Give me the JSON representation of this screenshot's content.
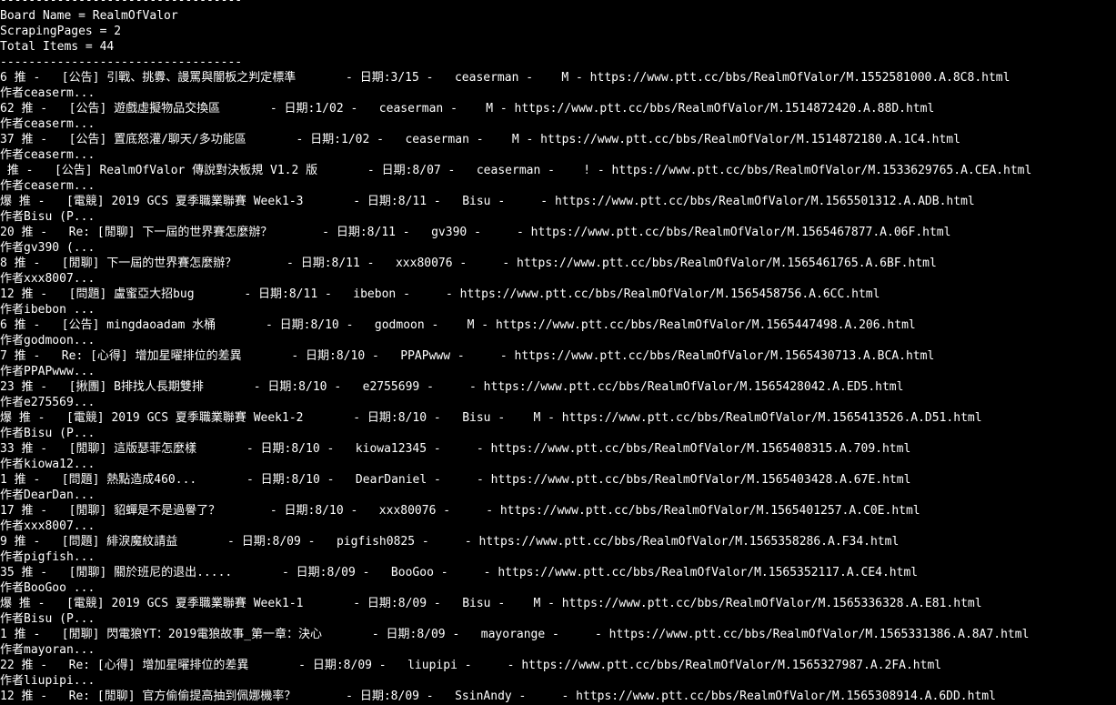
{
  "terminal": {
    "lines": [
      "----------------------------------",
      "Board Name = RealmOfValor",
      "ScrapingPages = 2",
      "Total Items = 44",
      "----------------------------------",
      "6 推 -   [公告] 引戰、挑釁、謾罵與闇板之判定標準       - 日期:3/15 -   ceaserman -    M - https://www.ptt.cc/bbs/RealmOfValor/M.1552581000.A.8C8.html",
      "作者ceaserm...",
      "62 推 -   [公告] 遊戲虛擬物品交換區       - 日期:1/02 -   ceaserman -    M - https://www.ptt.cc/bbs/RealmOfValor/M.1514872420.A.88D.html",
      "作者ceaserm...",
      "37 推 -   [公告] 置底怒灌/聊天/多功能區       - 日期:1/02 -   ceaserman -    M - https://www.ptt.cc/bbs/RealmOfValor/M.1514872180.A.1C4.html",
      "作者ceaserm...",
      " 推 -   [公告] RealmOfValor 傳說對決板規 V1.2 版       - 日期:8/07 -   ceaserman -    ! - https://www.ptt.cc/bbs/RealmOfValor/M.1533629765.A.CEA.html",
      "作者ceaserm...",
      "爆 推 -   [電競] 2019 GCS 夏季職業聯賽 Week1-3       - 日期:8/11 -   Bisu -     - https://www.ptt.cc/bbs/RealmOfValor/M.1565501312.A.ADB.html",
      "作者Bisu (P...",
      "20 推 -   Re: [閒聊] 下一屆的世界賽怎麼辦？       - 日期:8/11 -   gv390 -     - https://www.ptt.cc/bbs/RealmOfValor/M.1565467877.A.06F.html",
      "作者gv390 (...",
      "8 推 -   [閒聊] 下一屆的世界賽怎麼辦？       - 日期:8/11 -   xxx80076 -     - https://www.ptt.cc/bbs/RealmOfValor/M.1565461765.A.6BF.html",
      "作者xxx8007...",
      "12 推 -   [問題] 盧蜜亞大招bug       - 日期:8/11 -   ibebon -     - https://www.ptt.cc/bbs/RealmOfValor/M.1565458756.A.6CC.html",
      "作者ibebon ...",
      "6 推 -   [公告] mingdaoadam 水桶       - 日期:8/10 -   godmoon -    M - https://www.ptt.cc/bbs/RealmOfValor/M.1565447498.A.206.html",
      "作者godmoon...",
      "7 推 -   Re: [心得] 增加星曜排位的差異       - 日期:8/10 -   PPAPwww -     - https://www.ptt.cc/bbs/RealmOfValor/M.1565430713.A.BCA.html",
      "作者PPAPwww...",
      "23 推 -   [揪團] B排找人長期雙排       - 日期:8/10 -   e2755699 -     - https://www.ptt.cc/bbs/RealmOfValor/M.1565428042.A.ED5.html",
      "作者e275569...",
      "爆 推 -   [電競] 2019 GCS 夏季職業聯賽 Week1-2       - 日期:8/10 -   Bisu -    M - https://www.ptt.cc/bbs/RealmOfValor/M.1565413526.A.D51.html",
      "作者Bisu (P...",
      "33 推 -   [閒聊] 這版瑟菲怎麼樣       - 日期:8/10 -   kiowa12345 -     - https://www.ptt.cc/bbs/RealmOfValor/M.1565408315.A.709.html",
      "作者kiowa12...",
      "1 推 -   [問題] 熱點造成460...       - 日期:8/10 -   DearDaniel -     - https://www.ptt.cc/bbs/RealmOfValor/M.1565403428.A.67E.html",
      "作者DearDan...",
      "17 推 -   [閒聊] 貂蟬是不是過譽了？       - 日期:8/10 -   xxx80076 -     - https://www.ptt.cc/bbs/RealmOfValor/M.1565401257.A.C0E.html",
      "作者xxx8007...",
      "9 推 -   [問題] 緋淚魔紋請益       - 日期:8/09 -   pigfish0825 -     - https://www.ptt.cc/bbs/RealmOfValor/M.1565358286.A.F34.html",
      "作者pigfish...",
      "35 推 -   [閒聊] 關於班尼的退出.....       - 日期:8/09 -   BooGoo -     - https://www.ptt.cc/bbs/RealmOfValor/M.1565352117.A.CE4.html",
      "作者BooGoo ...",
      "爆 推 -   [電競] 2019 GCS 夏季職業聯賽 Week1-1       - 日期:8/09 -   Bisu -    M - https://www.ptt.cc/bbs/RealmOfValor/M.1565336328.A.E81.html",
      "作者Bisu (P...",
      "1 推 -   [閒聊] 閃電狼YT：2019電狼故事_第一章：決心       - 日期:8/09 -   mayorange -     - https://www.ptt.cc/bbs/RealmOfValor/M.1565331386.A.8A7.html",
      "作者mayoran...",
      "22 推 -   Re: [心得] 增加星曜排位的差異       - 日期:8/09 -   liupipi -     - https://www.ptt.cc/bbs/RealmOfValor/M.1565327987.A.2FA.html",
      "作者liupipi...",
      "12 推 -   Re: [閒聊] 官方偷偷提高抽到佩娜機率？       - 日期:8/09 -   SsinAndy -     - https://www.ptt.cc/bbs/RealmOfValor/M.1565308914.A.6DD.html"
    ]
  }
}
